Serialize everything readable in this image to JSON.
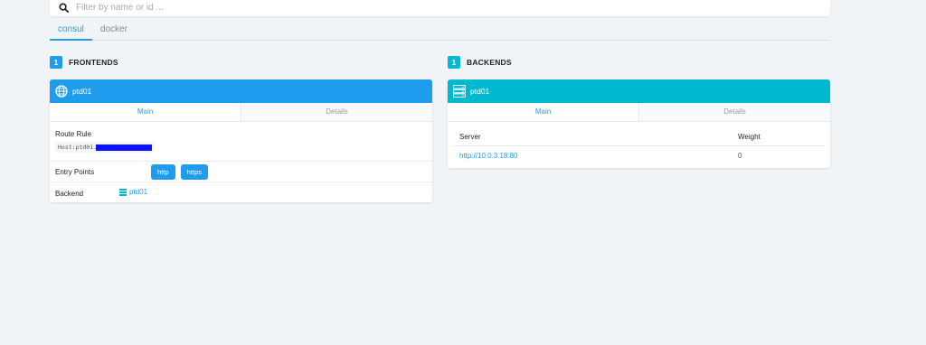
{
  "search": {
    "placeholder": "Filter by name or id ..."
  },
  "provider_tabs": [
    {
      "label": "consul",
      "active": true
    },
    {
      "label": "docker",
      "active": false
    }
  ],
  "frontends": {
    "count": "1",
    "title": "FRONTENDS",
    "color": "#209cee",
    "card": {
      "name": "ptd01",
      "icon": "globe-icon",
      "tabs": [
        "Main",
        "Details"
      ],
      "route_rule_label": "Route Rule",
      "route_rule_value": "Host:ptd01.",
      "entry_points_label": "Entry Points",
      "entry_points": [
        "http",
        "https"
      ],
      "backend_label": "Backend",
      "backend_value": "ptd01"
    }
  },
  "backends": {
    "count": "1",
    "title": "BACKENDS",
    "color": "#00b9d1",
    "card": {
      "name": "ptd01",
      "icon": "server-icon",
      "tabs": [
        "Main",
        "Details"
      ],
      "columns": [
        "Server",
        "Weight"
      ],
      "rows": [
        {
          "server": "http://10.0.3.18:80",
          "weight": "0"
        }
      ]
    }
  }
}
